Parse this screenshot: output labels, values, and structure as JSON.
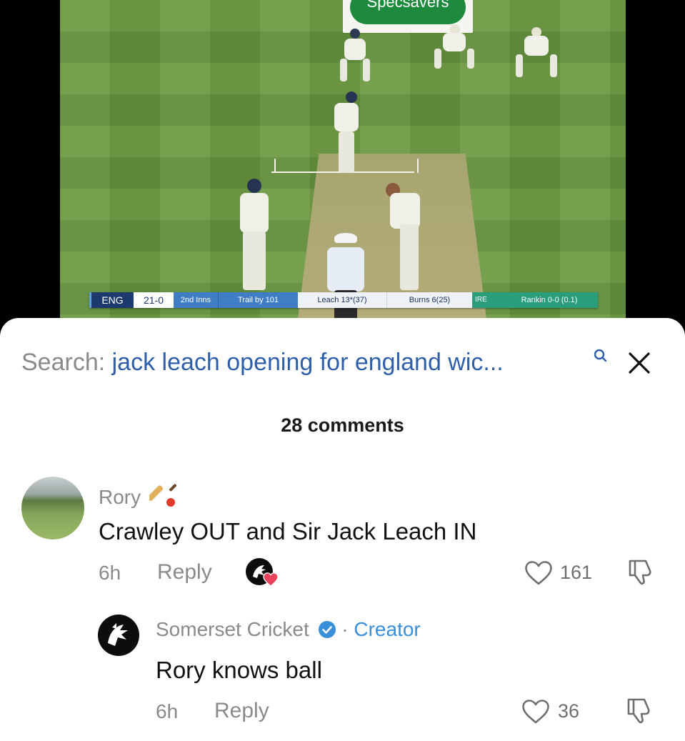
{
  "video": {
    "sponsor": "Specsavers",
    "scorebar": {
      "team": "ENG",
      "score": "21-0",
      "innings": "2nd Inns",
      "trail": "Trail by 101",
      "batter1": "Leach 13*(37)",
      "batter2": "Burns 6(25)",
      "bowling_team": "IRE",
      "bowler": "Rankin 0-0 (0.1)"
    }
  },
  "search": {
    "prefix": "Search: ",
    "query": "jack leach opening for england wic..."
  },
  "comments_header": "28 comments",
  "comments": [
    {
      "username": "Rory",
      "text": "Crawley OUT and Sir Jack Leach IN",
      "time": "6h",
      "reply_label": "Reply",
      "likes": "161",
      "icon": "cricket-bat-ball-icon",
      "creator_liked": true
    }
  ],
  "reply": {
    "username": "Somerset Cricket",
    "badge": "verified-icon",
    "separator": " · ",
    "role": "Creator",
    "text": "Rory knows ball",
    "time": "6h",
    "reply_label": "Reply",
    "likes": "36"
  },
  "colors": {
    "link_blue": "#2f5fa8",
    "creator_blue": "#3a8fd9",
    "heart_red": "#e8435a",
    "muted_text": "#8a8a8a"
  }
}
